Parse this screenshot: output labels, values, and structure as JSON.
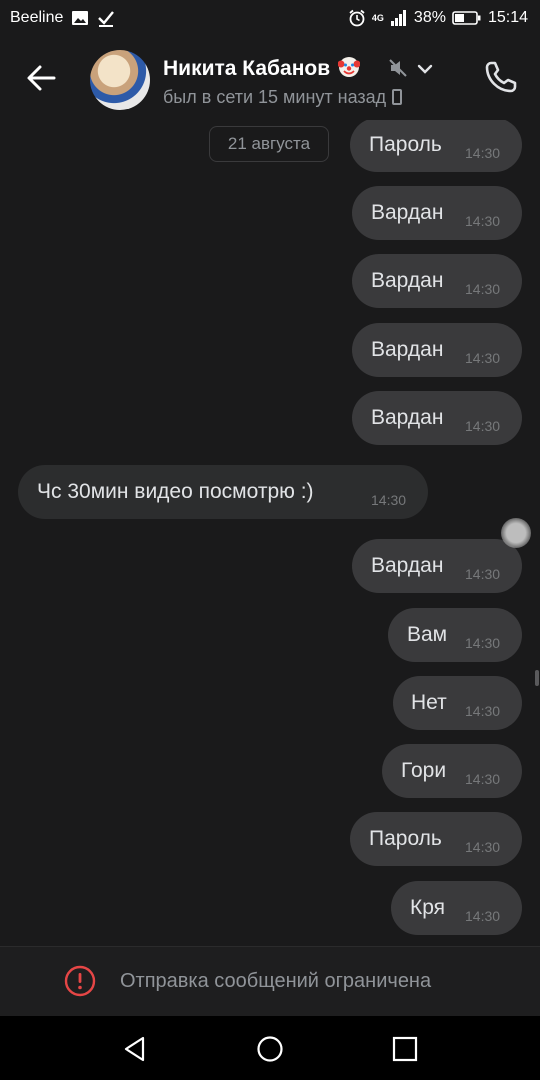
{
  "status_bar": {
    "carrier": "Beeline",
    "network": "4G",
    "battery": "38%",
    "time": "15:14"
  },
  "header": {
    "contact_name": "Никита Кабанов",
    "status": "был в сети 15 минут назад"
  },
  "chat": {
    "date_chip": "21 августа",
    "messages": [
      {
        "dir": "out",
        "text": "Пароль",
        "time": "14:30"
      },
      {
        "dir": "out",
        "text": "Вардан",
        "time": "14:30"
      },
      {
        "dir": "out",
        "text": "Вардан",
        "time": "14:30"
      },
      {
        "dir": "out",
        "text": "Вардан",
        "time": "14:30"
      },
      {
        "dir": "out",
        "text": "Вардан",
        "time": "14:30"
      },
      {
        "dir": "in",
        "text": "Чс 30мин видео посмотрю :)",
        "time": "14:30"
      },
      {
        "dir": "out",
        "text": "Вардан",
        "time": "14:30"
      },
      {
        "dir": "out",
        "text": "Вам",
        "time": "14:30"
      },
      {
        "dir": "out",
        "text": "Нет",
        "time": "14:30"
      },
      {
        "dir": "out",
        "text": "Гори",
        "time": "14:30"
      },
      {
        "dir": "out",
        "text": "Пароль",
        "time": "14:30"
      },
      {
        "dir": "out",
        "text": "Кря",
        "time": "14:30"
      }
    ]
  },
  "footer": {
    "restriction_text": "Отправка сообщений ограничена"
  },
  "colors": {
    "background": "#1a1a1b",
    "bubble_out": "#3a3a3c",
    "bubble_in": "#2c2d2e",
    "warning": "#e64646"
  }
}
